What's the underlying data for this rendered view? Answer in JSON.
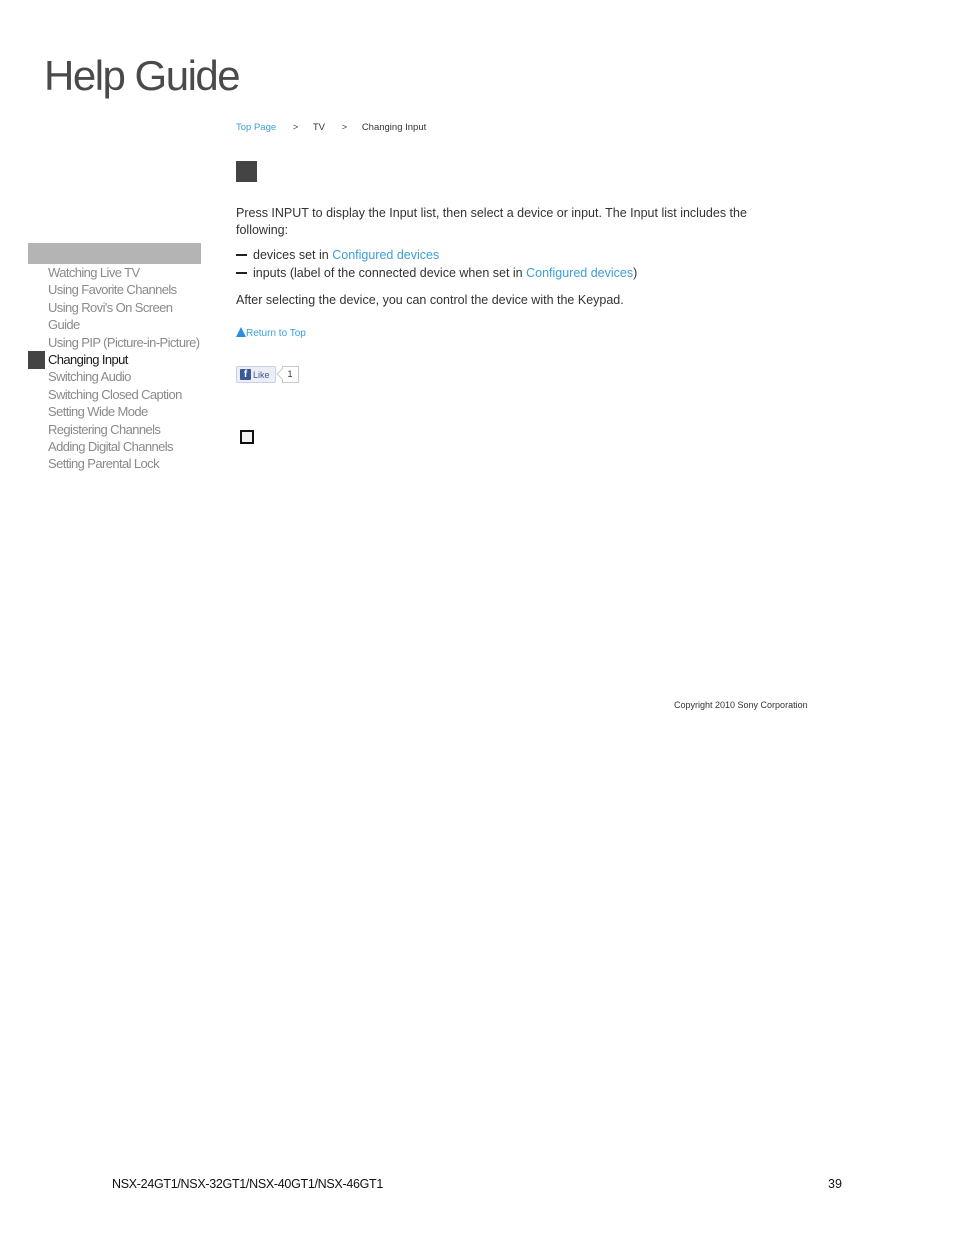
{
  "header": {
    "title": "Help Guide"
  },
  "breadcrumb": {
    "items": [
      {
        "label": "Top Page",
        "link": true
      },
      {
        "label": "TV",
        "link": false
      },
      {
        "label": "Changing Input",
        "link": false
      }
    ],
    "separator": ">"
  },
  "sidebar": {
    "items": [
      {
        "label": "Watching Live TV",
        "active": false
      },
      {
        "label": "Using Favorite Channels",
        "active": false
      },
      {
        "label": "Using Rovi's On Screen Guide",
        "active": false
      },
      {
        "label": "Using PIP (Picture-in-Picture)",
        "active": false
      },
      {
        "label": "Changing Input",
        "active": true
      },
      {
        "label": "Switching Audio",
        "active": false
      },
      {
        "label": "Switching Closed Caption",
        "active": false
      },
      {
        "label": "Setting Wide Mode",
        "active": false
      },
      {
        "label": "Registering Channels",
        "active": false
      },
      {
        "label": "Adding Digital Channels",
        "active": false
      },
      {
        "label": "Setting Parental Lock",
        "active": false
      }
    ]
  },
  "content": {
    "intro": "Press INPUT to display the Input list, then select a device or input. The Input list includes the following:",
    "bullets": [
      {
        "before": "devices set in ",
        "link": "Configured devices",
        "after": ""
      },
      {
        "before": "inputs (label of the connected device when set in ",
        "link": "Configured devices",
        "after": ")"
      }
    ],
    "outro": "After selecting the device, you can control the device with the Keypad."
  },
  "return_to_top": "Return to Top",
  "facebook": {
    "icon": "f",
    "like_label": "Like",
    "count": "1"
  },
  "copyright": "Copyright 2010 Sony Corporation",
  "footer": {
    "models": "NSX-24GT1/NSX-32GT1/NSX-40GT1/NSX-46GT1",
    "page_number": "39"
  }
}
